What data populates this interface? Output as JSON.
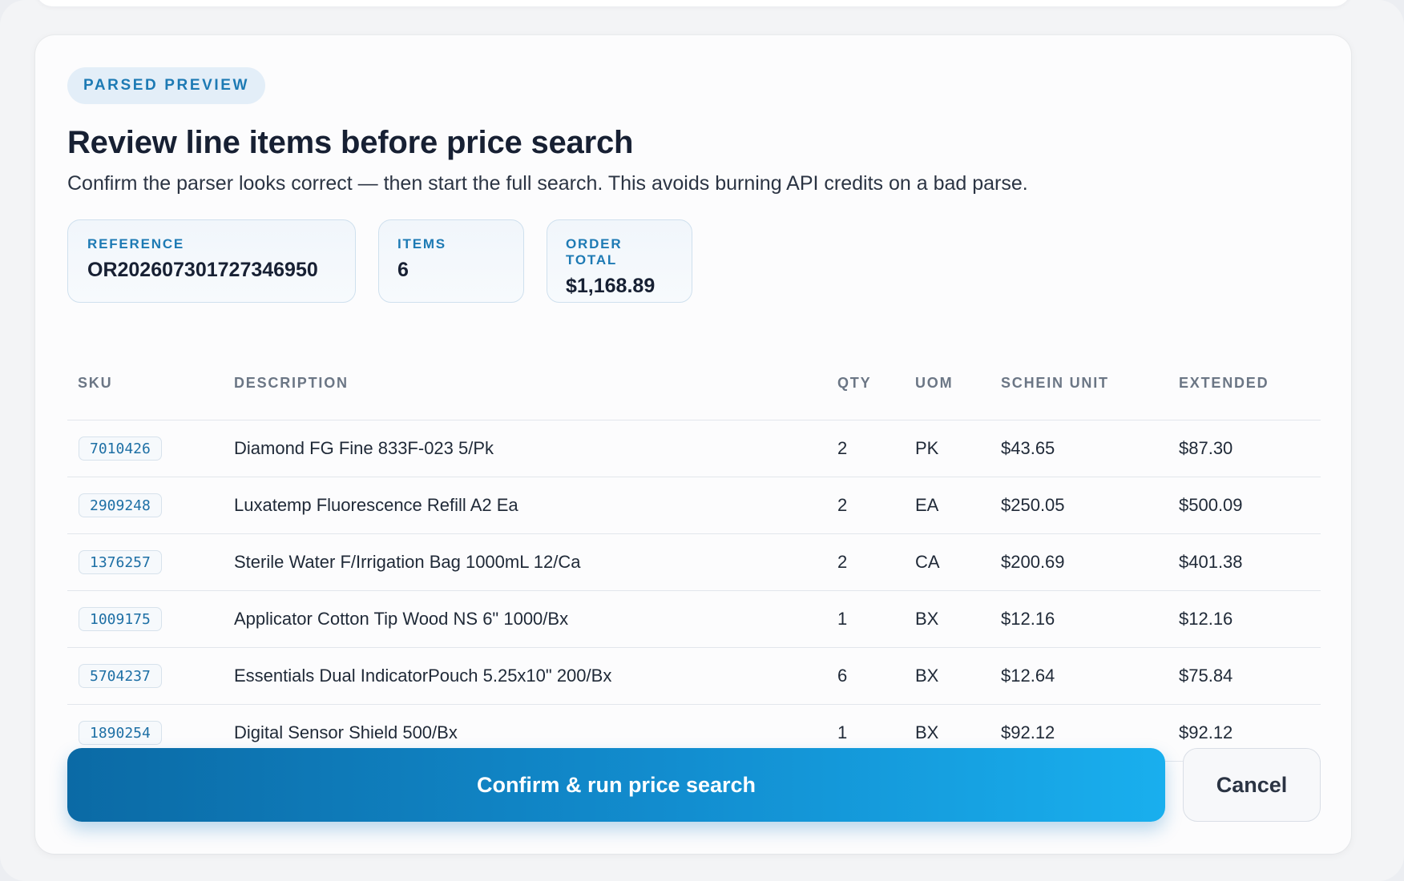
{
  "header": {
    "badge": "PARSED PREVIEW",
    "title": "Review line items before price search",
    "subtitle": "Confirm the parser looks correct — then start the full search. This avoids burning API credits on a bad parse."
  },
  "stats": {
    "reference": {
      "label": "REFERENCE",
      "value": "OR202607301727346950"
    },
    "items": {
      "label": "ITEMS",
      "value": "6"
    },
    "order_total": {
      "label": "ORDER TOTAL",
      "value": "$1,168.89"
    }
  },
  "table": {
    "columns": [
      "SKU",
      "DESCRIPTION",
      "QTY",
      "UOM",
      "SCHEIN UNIT",
      "EXTENDED"
    ],
    "rows": [
      {
        "sku": "7010426",
        "description": "Diamond FG Fine 833F-023 5/Pk",
        "qty": "2",
        "uom": "PK",
        "unit": "$43.65",
        "extended": "$87.30"
      },
      {
        "sku": "2909248",
        "description": "Luxatemp Fluorescence Refill A2 Ea",
        "qty": "2",
        "uom": "EA",
        "unit": "$250.05",
        "extended": "$500.09"
      },
      {
        "sku": "1376257",
        "description": "Sterile Water F/Irrigation Bag 1000mL 12/Ca",
        "qty": "2",
        "uom": "CA",
        "unit": "$200.69",
        "extended": "$401.38"
      },
      {
        "sku": "1009175",
        "description": "Applicator Cotton Tip Wood NS 6\" 1000/Bx",
        "qty": "1",
        "uom": "BX",
        "unit": "$12.16",
        "extended": "$12.16"
      },
      {
        "sku": "5704237",
        "description": "Essentials Dual IndicatorPouch 5.25x10\" 200/Bx",
        "qty": "6",
        "uom": "BX",
        "unit": "$12.64",
        "extended": "$75.84"
      },
      {
        "sku": "1890254",
        "description": "Digital Sensor Shield 500/Bx",
        "qty": "1",
        "uom": "BX",
        "unit": "$92.12",
        "extended": "$92.12"
      }
    ]
  },
  "actions": {
    "confirm_label": "Confirm & run price search",
    "cancel_label": "Cancel"
  },
  "colors": {
    "accent": "#1d7ab4",
    "primary_button_start": "#0b6aa5",
    "primary_button_end": "#19afee"
  }
}
